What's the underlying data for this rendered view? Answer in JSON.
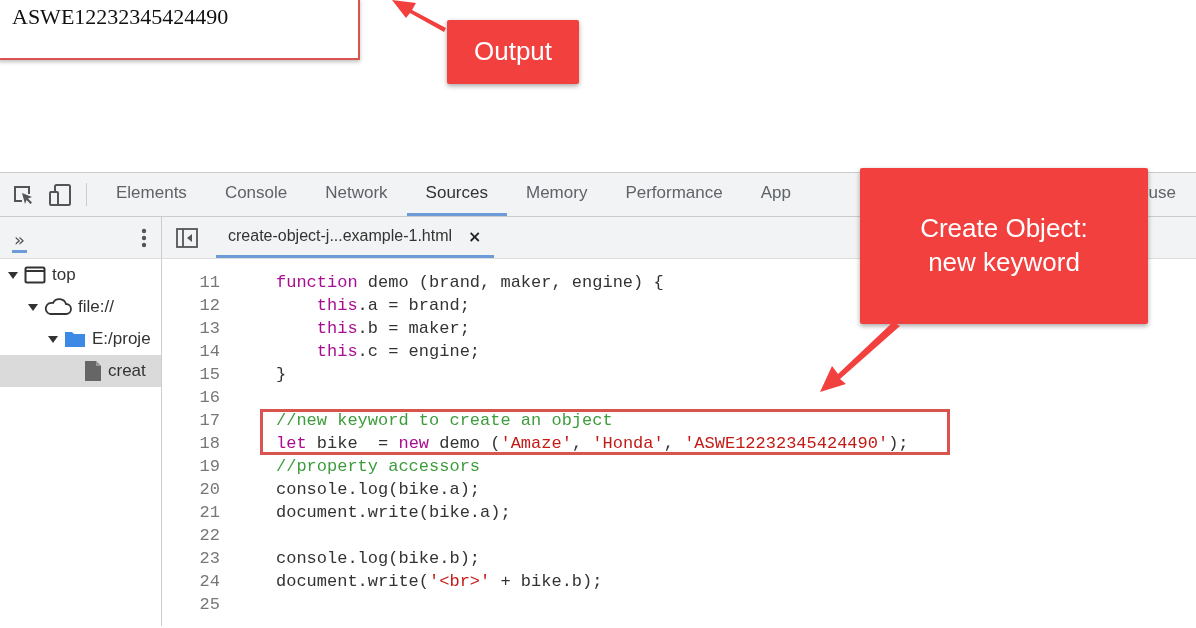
{
  "output_box": {
    "text": "ASWE12232345424490"
  },
  "callouts": [
    {
      "kind": "output",
      "text": "Output"
    },
    {
      "kind": "code",
      "text": "Create Object: new keyword"
    }
  ],
  "devtools": {
    "tabs": [
      {
        "label": "Elements",
        "selected": false
      },
      {
        "label": "Console",
        "selected": false
      },
      {
        "label": "Network",
        "selected": false
      },
      {
        "label": "Sources",
        "selected": true
      },
      {
        "label": "Memory",
        "selected": false
      },
      {
        "label": "Performance",
        "selected": false
      },
      {
        "label": "App",
        "selected": false
      },
      {
        "label": "use",
        "selected": false
      }
    ],
    "navigator_more": "»",
    "file_tab": {
      "label": "create-object-j...example-1.html",
      "close": "×",
      "selected": true
    },
    "tree": [
      {
        "kind": "frame",
        "label": "top",
        "expanded": true,
        "selected": false,
        "children": [
          {
            "kind": "origin",
            "label": "file://",
            "expanded": true,
            "selected": false,
            "children": [
              {
                "kind": "folder",
                "label": "E:/proje",
                "expanded": true,
                "selected": false,
                "children": [
                  {
                    "kind": "file",
                    "label": "creat",
                    "selected": true
                  }
                ]
              }
            ]
          }
        ]
      }
    ],
    "code_lines": [
      {
        "number": "11",
        "highlighted": false,
        "tokens": [
          {
            "kind": "keyword",
            "text": "function"
          },
          {
            "kind": "plain",
            "text": " demo (brand, maker, engine) {"
          }
        ]
      },
      {
        "number": "12",
        "highlighted": false,
        "indented": true,
        "tokens": [
          {
            "kind": "keyword",
            "text": "this"
          },
          {
            "kind": "plain",
            "text": ".a = brand;"
          }
        ]
      },
      {
        "number": "13",
        "highlighted": false,
        "indented": true,
        "tokens": [
          {
            "kind": "keyword",
            "text": "this"
          },
          {
            "kind": "plain",
            "text": ".b = maker;"
          }
        ]
      },
      {
        "number": "14",
        "highlighted": false,
        "indented": true,
        "tokens": [
          {
            "kind": "keyword",
            "text": "this"
          },
          {
            "kind": "plain",
            "text": ".c = engine;"
          }
        ]
      },
      {
        "number": "15",
        "highlighted": false,
        "tokens": [
          {
            "kind": "plain",
            "text": "}"
          }
        ]
      },
      {
        "number": "16",
        "highlighted": false
      },
      {
        "number": "17",
        "highlighted": true,
        "tokens": [
          {
            "kind": "comment",
            "text": "//new keyword to create an object"
          }
        ]
      },
      {
        "number": "18",
        "highlighted": true,
        "tokens": [
          {
            "kind": "keyword",
            "text": "let"
          },
          {
            "kind": "plain",
            "text": " bike  = "
          },
          {
            "kind": "keyword",
            "text": "new"
          },
          {
            "kind": "plain",
            "text": " demo ("
          },
          {
            "kind": "string",
            "text": "'Amaze'"
          },
          {
            "kind": "plain",
            "text": ", "
          },
          {
            "kind": "string",
            "text": "'Honda'"
          },
          {
            "kind": "plain",
            "text": ", "
          },
          {
            "kind": "string",
            "text": "'ASWE12232345424490'"
          },
          {
            "kind": "plain",
            "text": ");"
          }
        ]
      },
      {
        "number": "19",
        "highlighted": false,
        "tokens": [
          {
            "kind": "comment",
            "text": "//property accessors"
          }
        ]
      },
      {
        "number": "20",
        "highlighted": false,
        "tokens": [
          {
            "kind": "plain",
            "text": "console.log(bike.a);"
          }
        ]
      },
      {
        "number": "21",
        "highlighted": false,
        "tokens": [
          {
            "kind": "plain",
            "text": "document.write(bike.a);"
          }
        ]
      },
      {
        "number": "22",
        "highlighted": false
      },
      {
        "number": "23",
        "highlighted": false,
        "tokens": [
          {
            "kind": "plain",
            "text": "console.log(bike.b);"
          }
        ]
      },
      {
        "number": "24",
        "highlighted": false,
        "tokens": [
          {
            "kind": "plain",
            "text": "document.write("
          },
          {
            "kind": "string",
            "text": "'<br>'"
          },
          {
            "kind": "plain",
            "text": " + bike.b);"
          }
        ]
      },
      {
        "number": "25",
        "highlighted": false
      }
    ]
  }
}
